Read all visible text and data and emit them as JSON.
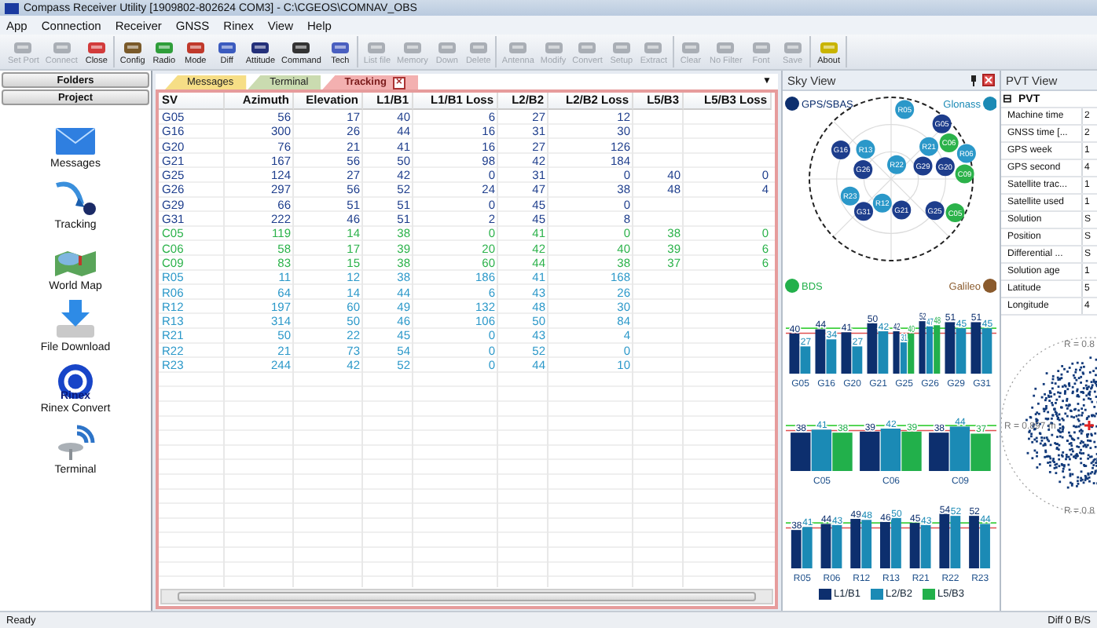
{
  "window": {
    "title": "Compass Receiver Utility [1909802-802624 COM3] - C:\\CGEOS\\COMNAV_OBS"
  },
  "menu": [
    "App",
    "Connection",
    "Receiver",
    "GNSS",
    "Rinex",
    "View",
    "Help"
  ],
  "toolbar": {
    "groups": [
      [
        {
          "label": "Set Port",
          "disabled": true
        },
        {
          "label": "Connect",
          "disabled": true
        },
        {
          "label": "Close",
          "disabled": false
        }
      ],
      [
        {
          "label": "Config",
          "disabled": false
        },
        {
          "label": "Radio",
          "disabled": false
        },
        {
          "label": "Mode",
          "disabled": false
        },
        {
          "label": "Diff",
          "disabled": false
        },
        {
          "label": "Attitude",
          "disabled": false
        },
        {
          "label": "Command",
          "disabled": false
        },
        {
          "label": "Tech",
          "disabled": false
        }
      ],
      [
        {
          "label": "List file",
          "disabled": true
        },
        {
          "label": "Memory",
          "disabled": true
        },
        {
          "label": "Down",
          "disabled": true
        },
        {
          "label": "Delete",
          "disabled": true
        }
      ],
      [
        {
          "label": "Antenna",
          "disabled": true
        },
        {
          "label": "Modify",
          "disabled": true
        },
        {
          "label": "Convert",
          "disabled": true
        },
        {
          "label": "Setup",
          "disabled": true
        },
        {
          "label": "Extract",
          "disabled": true
        }
      ],
      [
        {
          "label": "Clear",
          "disabled": true
        },
        {
          "label": "No Filter",
          "disabled": true
        },
        {
          "label": "Font",
          "disabled": true
        },
        {
          "label": "Save",
          "disabled": true
        }
      ],
      [
        {
          "label": "About",
          "disabled": false
        }
      ]
    ]
  },
  "sidebar": {
    "headers": [
      "Folders",
      "Project"
    ],
    "items": [
      {
        "label": "Messages"
      },
      {
        "label": "Tracking"
      },
      {
        "label": "World Map"
      },
      {
        "label": "File Download"
      },
      {
        "label": "Rinex Convert",
        "badge": "Rinex"
      },
      {
        "label": "Terminal"
      }
    ]
  },
  "tabs": [
    {
      "label": "Messages",
      "color": "#f6de86",
      "selected": false
    },
    {
      "label": "Terminal",
      "color": "#cadbb0",
      "selected": false
    },
    {
      "label": "Tracking",
      "color": "#f3b0b0",
      "selected": true
    }
  ],
  "tab_close": "×",
  "tab_menu": "▼",
  "table": {
    "columns": [
      "SV",
      "Azimuth",
      "Elevation",
      "L1/B1",
      "L1/B1 Loss",
      "L2/B2",
      "L2/B2 Loss",
      "L5/B3",
      "L5/B3 Loss"
    ],
    "rows": [
      {
        "color": "#1d3d8c",
        "cells": [
          "G05",
          "56",
          "17",
          "40",
          "6",
          "27",
          "12"
        ]
      },
      {
        "color": "#1d3d8c",
        "cells": [
          "G16",
          "300",
          "26",
          "44",
          "16",
          "31",
          "30"
        ]
      },
      {
        "color": "#1d3d8c",
        "cells": [
          "G20",
          "76",
          "21",
          "41",
          "16",
          "27",
          "126"
        ]
      },
      {
        "color": "#1d3d8c",
        "cells": [
          "G21",
          "167",
          "56",
          "50",
          "98",
          "42",
          "184"
        ]
      },
      {
        "color": "#1d3d8c",
        "cells": [
          "G25",
          "124",
          "27",
          "42",
          "0",
          "31",
          "0",
          "40",
          "0"
        ]
      },
      {
        "color": "#1d3d8c",
        "cells": [
          "G26",
          "297",
          "56",
          "52",
          "24",
          "47",
          "38",
          "48",
          "4"
        ]
      },
      {
        "color": "#1d3d8c",
        "cells": [
          "G29",
          "66",
          "51",
          "51",
          "0",
          "45",
          "0"
        ]
      },
      {
        "color": "#1d3d8c",
        "cells": [
          "G31",
          "222",
          "46",
          "51",
          "2",
          "45",
          "8"
        ]
      },
      {
        "color": "#2bb24a",
        "cells": [
          "C05",
          "119",
          "14",
          "38",
          "0",
          "41",
          "0",
          "38",
          "0"
        ]
      },
      {
        "color": "#2bb24a",
        "cells": [
          "C06",
          "58",
          "17",
          "39",
          "20",
          "42",
          "40",
          "39",
          "6"
        ]
      },
      {
        "color": "#2bb24a",
        "cells": [
          "C09",
          "83",
          "15",
          "38",
          "60",
          "44",
          "38",
          "37",
          "6"
        ]
      },
      {
        "color": "#2b98c9",
        "cells": [
          "R05",
          "11",
          "12",
          "38",
          "186",
          "41",
          "168"
        ]
      },
      {
        "color": "#2b98c9",
        "cells": [
          "R06",
          "64",
          "14",
          "44",
          "6",
          "43",
          "26"
        ]
      },
      {
        "color": "#2b98c9",
        "cells": [
          "R12",
          "197",
          "60",
          "49",
          "132",
          "48",
          "30"
        ]
      },
      {
        "color": "#2b98c9",
        "cells": [
          "R13",
          "314",
          "50",
          "46",
          "106",
          "50",
          "84"
        ]
      },
      {
        "color": "#2b98c9",
        "cells": [
          "R21",
          "50",
          "22",
          "45",
          "0",
          "43",
          "4"
        ]
      },
      {
        "color": "#2b98c9",
        "cells": [
          "R22",
          "21",
          "73",
          "54",
          "0",
          "52",
          "0"
        ]
      },
      {
        "color": "#2b98c9",
        "cells": [
          "R23",
          "244",
          "42",
          "52",
          "0",
          "44",
          "10"
        ]
      }
    ]
  },
  "sky": {
    "title": "Sky View",
    "legend": [
      {
        "label": "GPS/SBAS",
        "color": "#0d2f6e"
      },
      {
        "label": "Glonass",
        "color": "#1b8ab5"
      },
      {
        "label": "BDS",
        "color": "#22b04b"
      },
      {
        "label": "Galileo",
        "color": "#8a5a2c"
      }
    ],
    "satellites": [
      "G05",
      "G16",
      "G20",
      "G21",
      "G25",
      "G26",
      "G29",
      "G31",
      "C05",
      "C06",
      "C09",
      "R05",
      "R06",
      "R12",
      "R13",
      "R21",
      "R22",
      "R23"
    ]
  },
  "signal_panels": [
    {
      "chart_data": {
        "type": "bar",
        "categories": [
          "G05",
          "G16",
          "G20",
          "G21",
          "G25",
          "G26",
          "G29",
          "G31"
        ],
        "data_labels": true,
        "series": [
          {
            "name": "L1/B1",
            "color": "#0d2f6e",
            "values": [
              40,
              44,
              41,
              50,
              42,
              52,
              51,
              51
            ]
          },
          {
            "name": "L2/B2",
            "color": "#1b8ab5",
            "values": [
              27,
              34,
              27,
              42,
              31,
              47,
              45,
              45
            ]
          },
          {
            "name": "L5/B3",
            "color": "#22b04b",
            "values": [
              null,
              null,
              null,
              null,
              40,
              48,
              null,
              null
            ]
          }
        ],
        "ref_lines": [
          {
            "axis": "y",
            "value": 45,
            "color": "#3fcf3f"
          },
          {
            "axis": "y",
            "value": 40,
            "color": "#e05050"
          }
        ]
      }
    },
    {
      "chart_data": {
        "type": "bar",
        "categories": [
          "C05",
          "C06",
          "C09"
        ],
        "data_labels": true,
        "series": [
          {
            "color": "#0d2f6e",
            "values": [
              38,
              39,
              38
            ]
          },
          {
            "color": "#1b8ab5",
            "values": [
              41,
              42,
              44
            ]
          },
          {
            "color": "#22b04b",
            "values": [
              38,
              39,
              37
            ]
          }
        ],
        "ref_lines": [
          {
            "axis": "y",
            "value": 45,
            "color": "#3fcf3f"
          },
          {
            "axis": "y",
            "value": 40,
            "color": "#e05050"
          }
        ]
      }
    },
    {
      "chart_data": {
        "type": "bar",
        "categories": [
          "R05",
          "R06",
          "R12",
          "R13",
          "R21",
          "R22",
          "R23"
        ],
        "data_labels": true,
        "series": [
          {
            "color": "#0d2f6e",
            "values": [
              38,
              44,
              49,
              46,
              45,
              54,
              52
            ]
          },
          {
            "color": "#1b8ab5",
            "values": [
              41,
              43,
              48,
              50,
              43,
              52,
              44
            ]
          }
        ],
        "ref_lines": [
          {
            "axis": "y",
            "value": 45,
            "color": "#3fcf3f"
          },
          {
            "axis": "y",
            "value": 40,
            "color": "#e05050"
          }
        ]
      }
    }
  ],
  "pvt": {
    "title": "PVT View",
    "group": "PVT",
    "group_glyph": "⊟",
    "rows": [
      {
        "label": "Machine time",
        "value": "2"
      },
      {
        "label": "GNSS time [...",
        "value": "2"
      },
      {
        "label": "GPS week",
        "value": "1"
      },
      {
        "label": "GPS second",
        "value": "4"
      },
      {
        "label": "Satellite trac...",
        "value": "1"
      },
      {
        "label": "Satellite used",
        "value": "1"
      },
      {
        "label": "Solution",
        "value": "S"
      },
      {
        "label": "Position",
        "value": "S"
      },
      {
        "label": "Differential ...",
        "value": "S"
      },
      {
        "label": "Solution age",
        "value": "1"
      },
      {
        "label": "Latitude",
        "value": "5"
      },
      {
        "label": "Longitude",
        "value": "4"
      }
    ],
    "scatter_labels": [
      "R = 0.8",
      "R = 0.897 m",
      "R = 0.8"
    ]
  },
  "status": {
    "left": "Ready",
    "right": "Diff 0 B/S"
  }
}
